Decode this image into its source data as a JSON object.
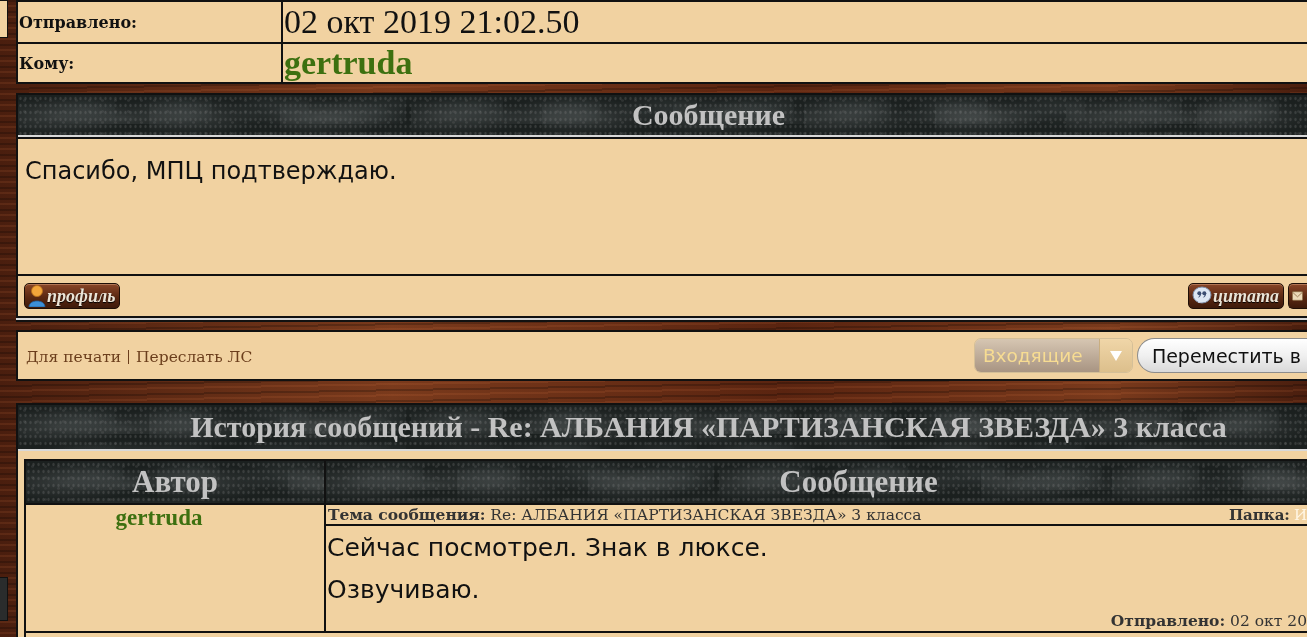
{
  "header_table": {
    "rows": [
      {
        "label": "Отправлено:",
        "value": "02 окт 2019 21:02.50",
        "kind": "date"
      },
      {
        "label": "Кому:",
        "value": "gertruda",
        "kind": "user"
      }
    ]
  },
  "message": {
    "title": "Сообщение",
    "body": "Спасибо, МПЦ подтверждаю.",
    "buttons": [
      {
        "kind": "profile",
        "label": "профиль"
      },
      {
        "kind": "quote",
        "label": "цитата"
      },
      {
        "kind": "partial"
      }
    ]
  },
  "actions": {
    "links": [
      "Для печати",
      "Переслать ЛС"
    ],
    "folder_select": {
      "value": "Входящие"
    },
    "move_button": "Переместить в"
  },
  "history": {
    "title": "История сообщений - Re: АЛБАНИЯ «ПАРТИЗАНСКАЯ ЗВЕЗДА» 3 класса",
    "columns": [
      "Автор",
      "Сообщение"
    ],
    "rows": [
      {
        "author": "gertruda",
        "subject": "**Тема сообщения:** Re: АЛБАНИЯ «ПАРТИЗАНСКАЯ ЗВЕЗДА» 3 класса",
        "folder_label": "Папка:",
        "folder_value": "И",
        "lines": [
          "Сейчас посмотрел. Знак в люксе.",
          "Озвучиваю."
        ],
        "sent": "**Отправлено:** 02 окт 20"
      }
    ]
  }
}
